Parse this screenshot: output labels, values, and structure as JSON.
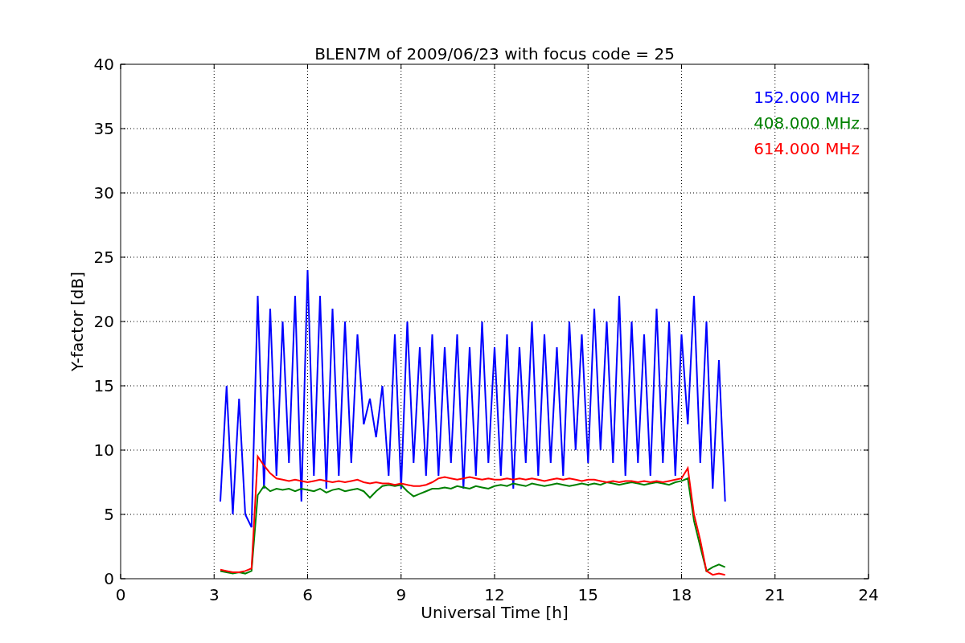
{
  "chart_data": {
    "type": "line",
    "grid": true,
    "title": "BLEN7M of 2009/06/23 with focus code = 25",
    "xlabel": "Universal Time [h]",
    "ylabel": "Y-factor [dB]",
    "xlim": [
      0,
      24
    ],
    "ylim": [
      0,
      40
    ],
    "xticks": [
      0,
      3,
      6,
      9,
      12,
      15,
      18,
      21,
      24
    ],
    "yticks": [
      0,
      5,
      10,
      15,
      20,
      25,
      30,
      35,
      40
    ],
    "x": [
      3.2,
      3.4,
      3.6,
      3.8,
      4,
      4.2,
      4.4,
      4.6,
      4.8,
      5,
      5.2,
      5.4,
      5.6,
      5.8,
      6,
      6.2,
      6.4,
      6.6,
      6.8,
      7,
      7.2,
      7.4,
      7.6,
      7.8,
      8,
      8.2,
      8.4,
      8.6,
      8.8,
      9,
      9.2,
      9.4,
      9.6,
      9.8,
      10,
      10.2,
      10.4,
      10.6,
      10.8,
      11,
      11.2,
      11.4,
      11.6,
      11.8,
      12,
      12.2,
      12.4,
      12.6,
      12.8,
      13,
      13.2,
      13.4,
      13.6,
      13.8,
      14,
      14.2,
      14.4,
      14.6,
      14.8,
      15,
      15.2,
      15.4,
      15.6,
      15.8,
      16,
      16.2,
      16.4,
      16.6,
      16.8,
      17,
      17.2,
      17.4,
      17.6,
      17.8,
      18,
      18.2,
      18.4,
      18.6,
      18.8,
      19,
      19.2,
      19.4
    ],
    "series": [
      {
        "name": "152.000 MHz",
        "color": "#0000ff",
        "values": [
          6,
          15,
          5,
          14,
          5,
          4,
          22,
          7,
          21,
          8,
          20,
          9,
          22,
          6,
          24,
          8,
          22,
          7,
          21,
          8,
          20,
          9,
          19,
          12,
          14,
          11,
          15,
          8,
          19,
          7,
          20,
          9,
          18,
          8,
          19,
          8,
          18,
          9,
          19,
          7,
          18,
          8,
          20,
          9,
          18,
          8,
          19,
          7,
          18,
          9,
          20,
          8,
          19,
          9,
          18,
          8,
          20,
          10,
          19,
          9,
          21,
          10,
          20,
          9,
          22,
          8,
          20,
          9,
          19,
          8,
          21,
          9,
          20,
          8,
          19,
          12,
          22,
          9,
          20,
          7,
          17,
          6
        ]
      },
      {
        "name": "408.000 MHz",
        "color": "#008000",
        "values": [
          0.6,
          0.5,
          0.4,
          0.5,
          0.4,
          0.6,
          6.5,
          7.2,
          6.8,
          7,
          6.9,
          7,
          6.8,
          7,
          6.9,
          6.8,
          7,
          6.7,
          6.9,
          7,
          6.8,
          6.9,
          7,
          6.8,
          6.3,
          6.8,
          7.2,
          7.3,
          7.2,
          7.3,
          6.8,
          6.4,
          6.6,
          6.8,
          7,
          7,
          7.1,
          7,
          7.2,
          7.1,
          7,
          7.2,
          7.1,
          7,
          7.2,
          7.3,
          7.2,
          7.4,
          7.3,
          7.2,
          7.4,
          7.3,
          7.2,
          7.3,
          7.4,
          7.3,
          7.2,
          7.3,
          7.4,
          7.3,
          7.4,
          7.3,
          7.5,
          7.4,
          7.3,
          7.4,
          7.5,
          7.4,
          7.3,
          7.4,
          7.5,
          7.4,
          7.3,
          7.5,
          7.6,
          7.8,
          4.5,
          2.5,
          0.6,
          0.9,
          1.1,
          0.9
        ]
      },
      {
        "name": "614.000 MHz",
        "color": "#ff0000",
        "values": [
          0.7,
          0.6,
          0.5,
          0.5,
          0.6,
          0.8,
          9.5,
          8.8,
          8.2,
          7.8,
          7.7,
          7.6,
          7.7,
          7.6,
          7.5,
          7.6,
          7.7,
          7.6,
          7.5,
          7.6,
          7.5,
          7.6,
          7.7,
          7.5,
          7.4,
          7.5,
          7.4,
          7.4,
          7.3,
          7.4,
          7.3,
          7.2,
          7.2,
          7.3,
          7.5,
          7.8,
          7.9,
          7.8,
          7.7,
          7.8,
          7.9,
          7.8,
          7.7,
          7.8,
          7.7,
          7.7,
          7.8,
          7.7,
          7.8,
          7.7,
          7.8,
          7.7,
          7.6,
          7.7,
          7.8,
          7.7,
          7.8,
          7.7,
          7.6,
          7.7,
          7.7,
          7.6,
          7.5,
          7.6,
          7.5,
          7.6,
          7.6,
          7.5,
          7.6,
          7.5,
          7.6,
          7.5,
          7.6,
          7.7,
          7.8,
          8.6,
          5,
          3,
          0.6,
          0.3,
          0.4,
          0.3
        ]
      }
    ]
  }
}
